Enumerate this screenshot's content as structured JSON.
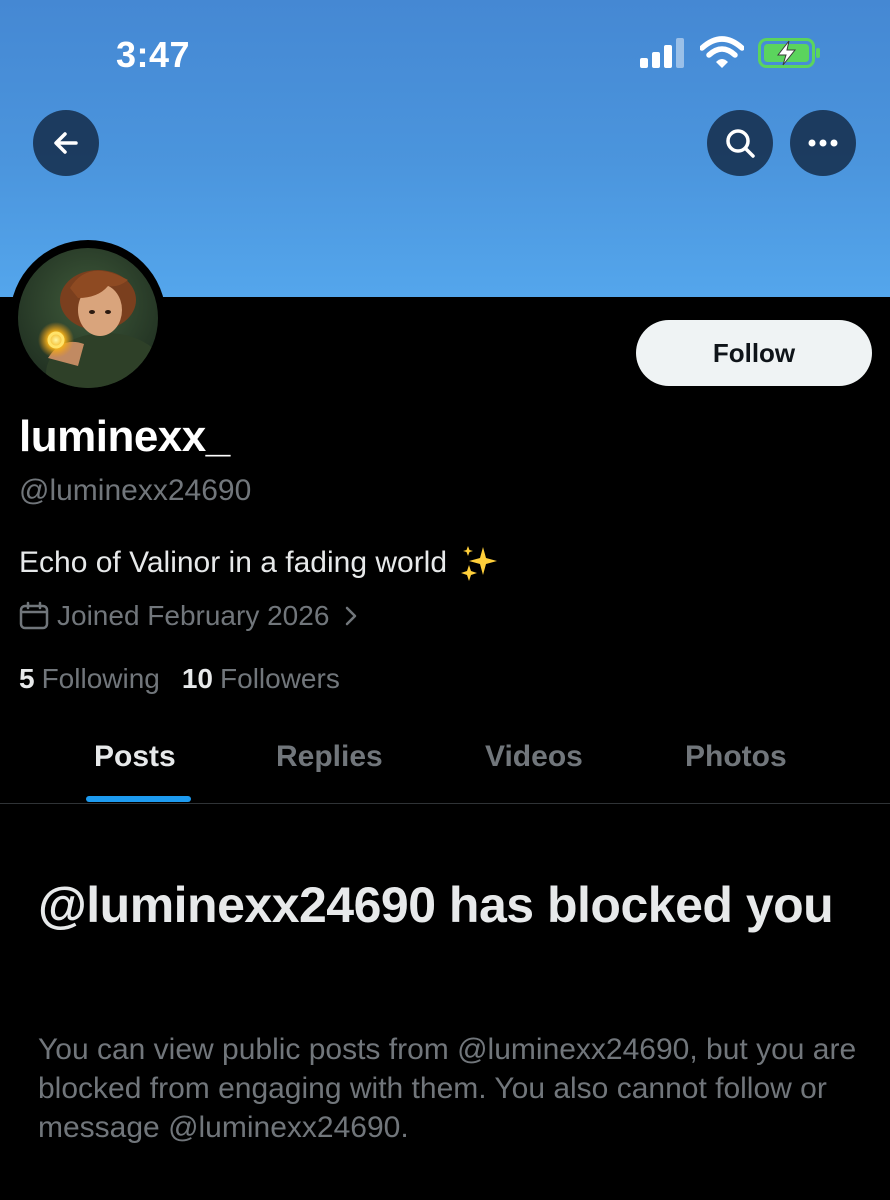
{
  "status_bar": {
    "time": "3:47",
    "icons": [
      "cellular-signal-icon",
      "wifi-icon",
      "battery-charging-icon"
    ],
    "battery_color": "#5bd45d"
  },
  "header": {
    "back_icon": "arrow-left-icon",
    "search_icon": "search-icon",
    "more_icon": "more-horizontal-icon",
    "banner_color": "#4b95dd"
  },
  "profile": {
    "display_name": "luminexx_",
    "handle": "@luminexx24690",
    "bio": "Echo of Valinor in a fading world",
    "bio_emoji": "sparkles-icon",
    "joined": "Joined February 2026",
    "follow_label": "Follow",
    "following_count": "5",
    "following_label": "Following",
    "followers_count": "10",
    "followers_label": "Followers"
  },
  "tabs": [
    {
      "label": "Posts",
      "active": true
    },
    {
      "label": "Replies",
      "active": false
    },
    {
      "label": "Videos",
      "active": false
    },
    {
      "label": "Photos",
      "active": false
    }
  ],
  "accent_color": "#1d9bf0",
  "blocked_notice": {
    "title": "@luminexx24690 has blocked you",
    "body": "You can view public posts from @luminexx24690, but you are blocked from engaging with them. You also cannot follow or message @luminexx24690."
  }
}
